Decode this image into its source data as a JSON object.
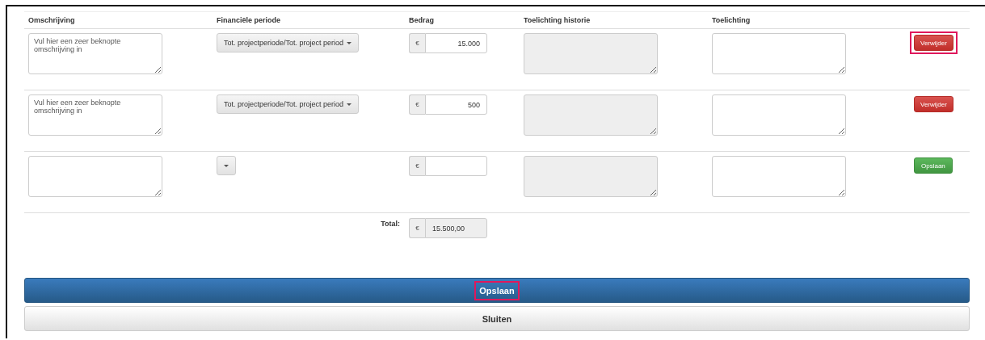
{
  "columns": [
    "Omschrijving",
    "Financiële periode",
    "Bedrag",
    "Toelichting historie",
    "Toelichting"
  ],
  "rows": [
    {
      "description": "Vul hier een zeer beknopte omschrijving in",
      "period": "Tot. projectperiode/Tot. project period",
      "currency": "€",
      "amount": "15.000",
      "action": {
        "kind": "delete",
        "label": "Verwijder",
        "highlighted": true
      }
    },
    {
      "description": "Vul hier een zeer beknopte omschrijving in",
      "period": "Tot. projectperiode/Tot. project period",
      "currency": "€",
      "amount": "500",
      "action": {
        "kind": "delete",
        "label": "Verwijder",
        "highlighted": false
      }
    },
    {
      "currency": "€",
      "action": {
        "kind": "save",
        "label": "Opslaan",
        "highlighted": false
      }
    }
  ],
  "total": {
    "label": "Total:",
    "currency": "€",
    "value": "15.500,00"
  },
  "buttons": [
    {
      "kind": "primary",
      "label": "Opslaan",
      "highlighted": true
    },
    {
      "kind": "default",
      "label": "Sluiten",
      "highlighted": false
    }
  ]
}
